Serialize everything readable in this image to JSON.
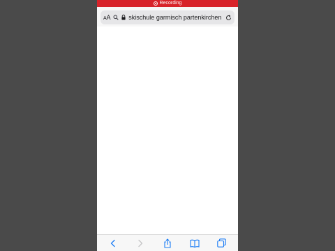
{
  "recording": {
    "label": "Recording"
  },
  "address_bar": {
    "reader_label_small": "A",
    "reader_label_large": "A",
    "url": "skischule garmisch partenkirchen"
  },
  "colors": {
    "accent": "#1a7cf5",
    "recording": "#d8232a",
    "disabled": "#c4c4c6"
  },
  "toolbar": {
    "items": [
      "back-icon",
      "forward-icon",
      "share-icon",
      "bookmarks-icon",
      "tabs-icon"
    ]
  }
}
